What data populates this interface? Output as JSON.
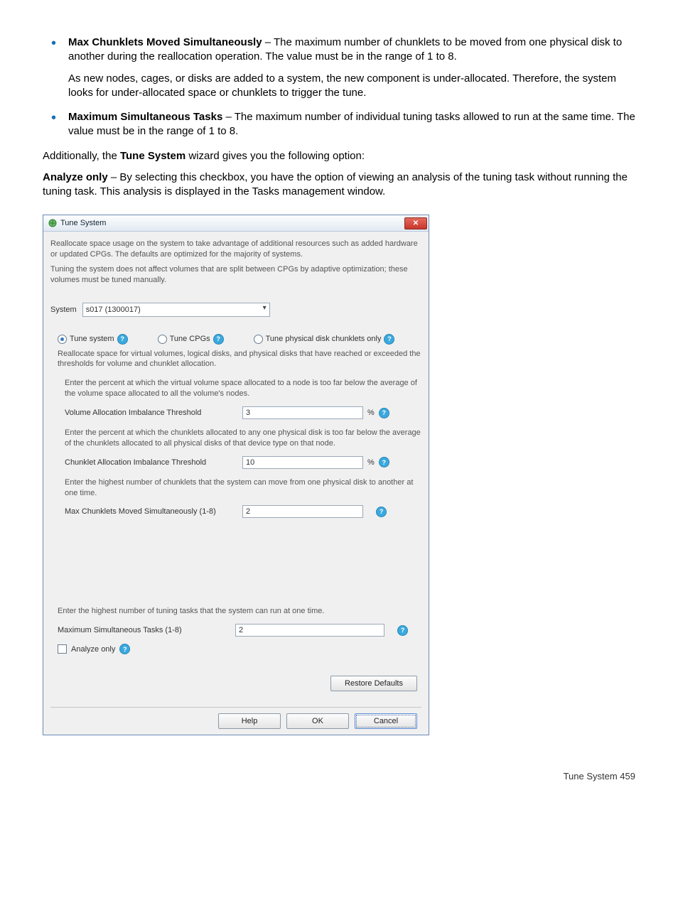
{
  "doc": {
    "bullet1_strong": "Max Chunklets Moved Simultaneously",
    "bullet1_text": " – The maximum number of chunklets to be moved from one physical disk to another during the reallocation operation. The value must be in the range of 1 to 8.",
    "bullet1_sub": "As new nodes, cages, or disks are added to a system, the new component is under-allocated. Therefore, the system looks for under-allocated space or chunklets to trigger the tune.",
    "bullet2_strong": "Maximum Simultaneous Tasks",
    "bullet2_text": " – The maximum number of individual tuning tasks allowed to run at the same time. The value must be in the range of 1 to 8.",
    "para_additional_pre": "Additionally, the ",
    "para_additional_strong": "Tune System",
    "para_additional_post": " wizard gives you the following option:",
    "analyze_strong": "Analyze only",
    "analyze_text": " – By selecting this checkbox, you have the option of viewing an analysis of the tuning task without running the tuning task. This analysis is displayed in the Tasks management window."
  },
  "dialog": {
    "title": "Tune System",
    "intro1": "Reallocate space usage on the system to take advantage of additional resources such as added hardware or updated CPGs. The defaults are optimized for the majority of systems.",
    "intro2": "Tuning the system does not affect volumes that are split between CPGs by adaptive optimization; these volumes must be tuned manually.",
    "system_label": "System",
    "system_value": "s017 (1300017)",
    "radio_tune_system": "Tune system",
    "radio_tune_cpgs": "Tune CPGs",
    "radio_tune_pd": "Tune physical disk chunklets only",
    "tune_desc": "Reallocate space for virtual volumes, logical disks, and physical disks that have reached or exceeded the thresholds for volume and chunklet allocation.",
    "vol_desc": "Enter the percent at which the virtual volume space allocated to a node is too far below the average of the volume space allocated to all the volume's nodes.",
    "vol_label": "Volume Allocation Imbalance Threshold",
    "vol_value": "3",
    "chunk_desc": "Enter the percent at which the chunklets allocated to any one physical disk is too far below the average of the chunklets allocated to all physical disks of that device type on that node.",
    "chunk_label": "Chunklet Allocation Imbalance Threshold",
    "chunk_value": "10",
    "max_chunk_desc": "Enter the highest number of chunklets that the system can move from one physical disk to another at one time.",
    "max_chunk_label": "Max Chunklets Moved Simultaneously  (1-8)",
    "max_chunk_value": "2",
    "tasks_desc": "Enter the highest number of tuning tasks that the system can run at one time.",
    "tasks_label": "Maximum Simultaneous Tasks  (1-8)",
    "tasks_value": "2",
    "analyze_label": "Analyze only",
    "restore": "Restore Defaults",
    "help": "Help",
    "ok": "OK",
    "cancel": "Cancel",
    "percent": "%"
  },
  "page_footer": "Tune System   459"
}
